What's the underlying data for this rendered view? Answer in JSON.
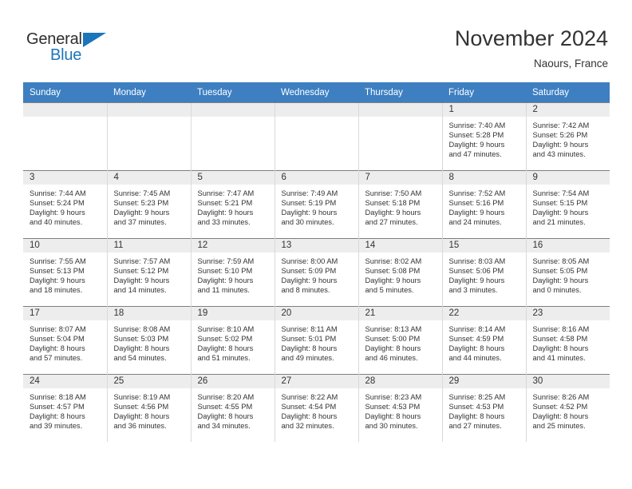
{
  "brand": {
    "name_part1": "General",
    "name_part2": "Blue",
    "primary_color": "#1b75bb",
    "triangle_icon": "triangle-icon"
  },
  "header": {
    "title": "November 2024",
    "subtitle": "Naours, France"
  },
  "calendar": {
    "header_bg": "#3d7fc1",
    "daynum_bg": "#ededed",
    "weekday_headers": [
      "Sunday",
      "Monday",
      "Tuesday",
      "Wednesday",
      "Thursday",
      "Friday",
      "Saturday"
    ],
    "weeks": [
      [
        {
          "day": "",
          "sunrise": "",
          "sunset": "",
          "daylight1": "",
          "daylight2": ""
        },
        {
          "day": "",
          "sunrise": "",
          "sunset": "",
          "daylight1": "",
          "daylight2": ""
        },
        {
          "day": "",
          "sunrise": "",
          "sunset": "",
          "daylight1": "",
          "daylight2": ""
        },
        {
          "day": "",
          "sunrise": "",
          "sunset": "",
          "daylight1": "",
          "daylight2": ""
        },
        {
          "day": "",
          "sunrise": "",
          "sunset": "",
          "daylight1": "",
          "daylight2": ""
        },
        {
          "day": "1",
          "sunrise": "Sunrise: 7:40 AM",
          "sunset": "Sunset: 5:28 PM",
          "daylight1": "Daylight: 9 hours",
          "daylight2": "and 47 minutes."
        },
        {
          "day": "2",
          "sunrise": "Sunrise: 7:42 AM",
          "sunset": "Sunset: 5:26 PM",
          "daylight1": "Daylight: 9 hours",
          "daylight2": "and 43 minutes."
        }
      ],
      [
        {
          "day": "3",
          "sunrise": "Sunrise: 7:44 AM",
          "sunset": "Sunset: 5:24 PM",
          "daylight1": "Daylight: 9 hours",
          "daylight2": "and 40 minutes."
        },
        {
          "day": "4",
          "sunrise": "Sunrise: 7:45 AM",
          "sunset": "Sunset: 5:23 PM",
          "daylight1": "Daylight: 9 hours",
          "daylight2": "and 37 minutes."
        },
        {
          "day": "5",
          "sunrise": "Sunrise: 7:47 AM",
          "sunset": "Sunset: 5:21 PM",
          "daylight1": "Daylight: 9 hours",
          "daylight2": "and 33 minutes."
        },
        {
          "day": "6",
          "sunrise": "Sunrise: 7:49 AM",
          "sunset": "Sunset: 5:19 PM",
          "daylight1": "Daylight: 9 hours",
          "daylight2": "and 30 minutes."
        },
        {
          "day": "7",
          "sunrise": "Sunrise: 7:50 AM",
          "sunset": "Sunset: 5:18 PM",
          "daylight1": "Daylight: 9 hours",
          "daylight2": "and 27 minutes."
        },
        {
          "day": "8",
          "sunrise": "Sunrise: 7:52 AM",
          "sunset": "Sunset: 5:16 PM",
          "daylight1": "Daylight: 9 hours",
          "daylight2": "and 24 minutes."
        },
        {
          "day": "9",
          "sunrise": "Sunrise: 7:54 AM",
          "sunset": "Sunset: 5:15 PM",
          "daylight1": "Daylight: 9 hours",
          "daylight2": "and 21 minutes."
        }
      ],
      [
        {
          "day": "10",
          "sunrise": "Sunrise: 7:55 AM",
          "sunset": "Sunset: 5:13 PM",
          "daylight1": "Daylight: 9 hours",
          "daylight2": "and 18 minutes."
        },
        {
          "day": "11",
          "sunrise": "Sunrise: 7:57 AM",
          "sunset": "Sunset: 5:12 PM",
          "daylight1": "Daylight: 9 hours",
          "daylight2": "and 14 minutes."
        },
        {
          "day": "12",
          "sunrise": "Sunrise: 7:59 AM",
          "sunset": "Sunset: 5:10 PM",
          "daylight1": "Daylight: 9 hours",
          "daylight2": "and 11 minutes."
        },
        {
          "day": "13",
          "sunrise": "Sunrise: 8:00 AM",
          "sunset": "Sunset: 5:09 PM",
          "daylight1": "Daylight: 9 hours",
          "daylight2": "and 8 minutes."
        },
        {
          "day": "14",
          "sunrise": "Sunrise: 8:02 AM",
          "sunset": "Sunset: 5:08 PM",
          "daylight1": "Daylight: 9 hours",
          "daylight2": "and 5 minutes."
        },
        {
          "day": "15",
          "sunrise": "Sunrise: 8:03 AM",
          "sunset": "Sunset: 5:06 PM",
          "daylight1": "Daylight: 9 hours",
          "daylight2": "and 3 minutes."
        },
        {
          "day": "16",
          "sunrise": "Sunrise: 8:05 AM",
          "sunset": "Sunset: 5:05 PM",
          "daylight1": "Daylight: 9 hours",
          "daylight2": "and 0 minutes."
        }
      ],
      [
        {
          "day": "17",
          "sunrise": "Sunrise: 8:07 AM",
          "sunset": "Sunset: 5:04 PM",
          "daylight1": "Daylight: 8 hours",
          "daylight2": "and 57 minutes."
        },
        {
          "day": "18",
          "sunrise": "Sunrise: 8:08 AM",
          "sunset": "Sunset: 5:03 PM",
          "daylight1": "Daylight: 8 hours",
          "daylight2": "and 54 minutes."
        },
        {
          "day": "19",
          "sunrise": "Sunrise: 8:10 AM",
          "sunset": "Sunset: 5:02 PM",
          "daylight1": "Daylight: 8 hours",
          "daylight2": "and 51 minutes."
        },
        {
          "day": "20",
          "sunrise": "Sunrise: 8:11 AM",
          "sunset": "Sunset: 5:01 PM",
          "daylight1": "Daylight: 8 hours",
          "daylight2": "and 49 minutes."
        },
        {
          "day": "21",
          "sunrise": "Sunrise: 8:13 AM",
          "sunset": "Sunset: 5:00 PM",
          "daylight1": "Daylight: 8 hours",
          "daylight2": "and 46 minutes."
        },
        {
          "day": "22",
          "sunrise": "Sunrise: 8:14 AM",
          "sunset": "Sunset: 4:59 PM",
          "daylight1": "Daylight: 8 hours",
          "daylight2": "and 44 minutes."
        },
        {
          "day": "23",
          "sunrise": "Sunrise: 8:16 AM",
          "sunset": "Sunset: 4:58 PM",
          "daylight1": "Daylight: 8 hours",
          "daylight2": "and 41 minutes."
        }
      ],
      [
        {
          "day": "24",
          "sunrise": "Sunrise: 8:18 AM",
          "sunset": "Sunset: 4:57 PM",
          "daylight1": "Daylight: 8 hours",
          "daylight2": "and 39 minutes."
        },
        {
          "day": "25",
          "sunrise": "Sunrise: 8:19 AM",
          "sunset": "Sunset: 4:56 PM",
          "daylight1": "Daylight: 8 hours",
          "daylight2": "and 36 minutes."
        },
        {
          "day": "26",
          "sunrise": "Sunrise: 8:20 AM",
          "sunset": "Sunset: 4:55 PM",
          "daylight1": "Daylight: 8 hours",
          "daylight2": "and 34 minutes."
        },
        {
          "day": "27",
          "sunrise": "Sunrise: 8:22 AM",
          "sunset": "Sunset: 4:54 PM",
          "daylight1": "Daylight: 8 hours",
          "daylight2": "and 32 minutes."
        },
        {
          "day": "28",
          "sunrise": "Sunrise: 8:23 AM",
          "sunset": "Sunset: 4:53 PM",
          "daylight1": "Daylight: 8 hours",
          "daylight2": "and 30 minutes."
        },
        {
          "day": "29",
          "sunrise": "Sunrise: 8:25 AM",
          "sunset": "Sunset: 4:53 PM",
          "daylight1": "Daylight: 8 hours",
          "daylight2": "and 27 minutes."
        },
        {
          "day": "30",
          "sunrise": "Sunrise: 8:26 AM",
          "sunset": "Sunset: 4:52 PM",
          "daylight1": "Daylight: 8 hours",
          "daylight2": "and 25 minutes."
        }
      ]
    ]
  }
}
